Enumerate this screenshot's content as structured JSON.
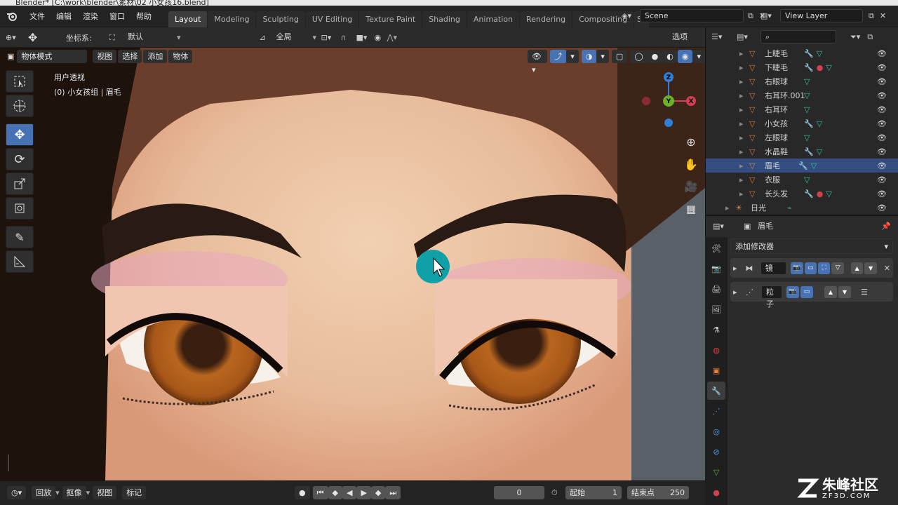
{
  "window": {
    "title": "Blender* [C:\\work\\blender\\素材\\02 小女孩16.blend]"
  },
  "menu": [
    "文件",
    "编辑",
    "渲染",
    "窗口",
    "帮助"
  ],
  "workspaces": [
    "Layout",
    "Modeling",
    "Sculpting",
    "UV Editing",
    "Texture Paint",
    "Shading",
    "Animation",
    "Rendering",
    "Compositing",
    "Sc"
  ],
  "active_workspace": "Layout",
  "scene": {
    "label": "Scene"
  },
  "view_layer": {
    "label": "View Layer"
  },
  "tool_header": {
    "coord_label": "坐标系:",
    "coord_value": "默认",
    "transform_orient": "全局",
    "options": "选项"
  },
  "viewport_header": {
    "mode": "物体模式",
    "menus": [
      "视图",
      "选择",
      "添加",
      "物体"
    ]
  },
  "viewport_overlay": {
    "view_name": "用户透视",
    "object_info": "(0) 小女孩组 | 眉毛"
  },
  "outliner": {
    "items": [
      {
        "name": "上睫毛",
        "selected": false
      },
      {
        "name": "下睫毛",
        "selected": false
      },
      {
        "name": "右眼球",
        "selected": false
      },
      {
        "name": "右耳环.001",
        "selected": false
      },
      {
        "name": "右耳环",
        "selected": false
      },
      {
        "name": "小女孩",
        "selected": false
      },
      {
        "name": "左眼球",
        "selected": false
      },
      {
        "name": "水晶鞋",
        "selected": false
      },
      {
        "name": "眉毛",
        "selected": true
      },
      {
        "name": "衣服",
        "selected": false
      },
      {
        "name": "长头发",
        "selected": false
      }
    ],
    "light": "日光"
  },
  "properties": {
    "object_name": "眉毛",
    "add_modifier": "添加修改器",
    "modifiers": [
      {
        "name": "镜"
      },
      {
        "name": "粒子"
      }
    ]
  },
  "timeline": {
    "menus": [
      "回放",
      "抠像",
      "视图",
      "标记"
    ],
    "current_frame": "0",
    "start_label": "起始",
    "start_value": "1",
    "end_label": "结束点",
    "end_value": "250"
  },
  "watermark": {
    "brand": "朱峰社区",
    "url": "ZF3D.COM"
  },
  "colors": {
    "accent": "#4772b3",
    "selected_row": "#334d80",
    "cursor_dot": "#0fa0a8",
    "mesh_icon": "#e0803a"
  }
}
